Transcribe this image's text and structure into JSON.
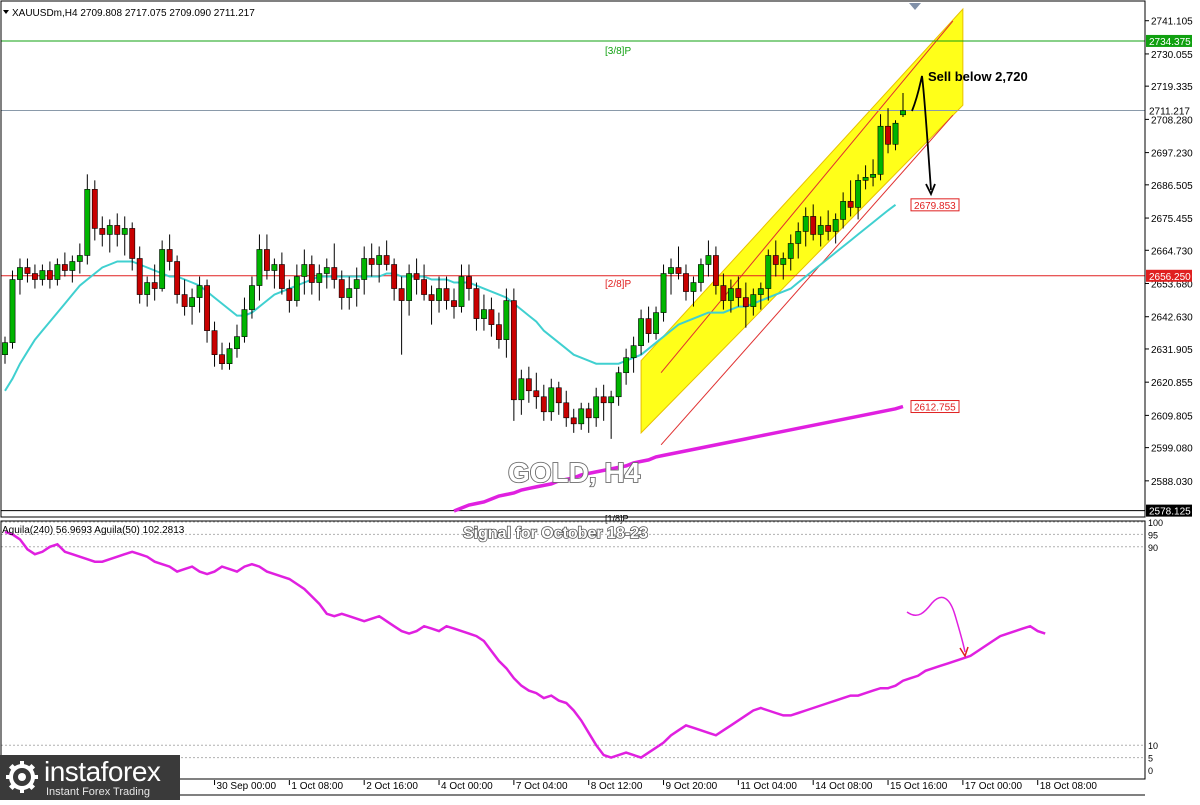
{
  "header": {
    "symbol_line": "XAUUSDm,H4  2709.808 2717.075 2709.090 2711.217"
  },
  "indicator_header": "Aguila(240) 56.9693  Aguila(50) 102.2813",
  "watermark": {
    "title": "GOLD, H4",
    "signal": "Signal for October 18-23"
  },
  "annotation": {
    "sell_text": "Sell below 2,720"
  },
  "murray_labels": {
    "upper": "[3/8]P",
    "middle": "[2/8]P",
    "lower": "[1/8]P"
  },
  "price_tags": {
    "last": "2711.217",
    "upper_line": "2734.375",
    "red_line": "2656.250",
    "ma_fast": "2679.853",
    "ma_slow": "2612.755",
    "bottom": "2578.125"
  },
  "logo": {
    "brand": "instaforex",
    "tagline": "Instant Forex Trading",
    "icon": "gear-logo-icon"
  },
  "colors": {
    "bull": "#00b400",
    "bear": "#c80000",
    "ma_fast": "#40d0d0",
    "ma_slow": "#e020e0",
    "channel": "#ffff00",
    "channel_edge": "#e8c000",
    "red_level": "#e02020",
    "green_level": "#10a010",
    "oscillator": "#e020e0"
  },
  "chart_data": {
    "type": "candlestick",
    "symbol": "XAUUSDm",
    "timeframe": "H4",
    "ylim": [
      2577,
      2746
    ],
    "y_ticks": [
      "2741.105",
      "2730.055",
      "2719.335",
      "2708.280",
      "2697.230",
      "2686.505",
      "2675.455",
      "2664.730",
      "2653.680",
      "2642.630",
      "2631.905",
      "2620.855",
      "2609.805",
      "2599.080",
      "2588.030"
    ],
    "x_ticks": [
      "30 Sep 00:00",
      "1 Oct 08:00",
      "2 Oct 16:00",
      "4 Oct 00:00",
      "7 Oct 04:00",
      "8 Oct 12:00",
      "9 Oct 20:00",
      "11 Oct 04:00",
      "14 Oct 08:00",
      "15 Oct 16:00",
      "17 Oct 00:00",
      "18 Oct 08:00"
    ],
    "x_tick_bar_index": [
      28,
      38,
      48,
      58,
      68,
      78,
      88,
      98,
      108,
      118,
      128,
      138
    ],
    "candles": [
      [
        2630,
        2636,
        2627,
        2634
      ],
      [
        2634,
        2658,
        2632,
        2655
      ],
      [
        2655,
        2662,
        2650,
        2659
      ],
      [
        2659,
        2662,
        2654,
        2657
      ],
      [
        2657,
        2660,
        2652,
        2655
      ],
      [
        2655,
        2660,
        2653,
        2658
      ],
      [
        2658,
        2661,
        2652,
        2655
      ],
      [
        2655,
        2662,
        2653,
        2660
      ],
      [
        2660,
        2664,
        2656,
        2658
      ],
      [
        2658,
        2663,
        2654,
        2661
      ],
      [
        2661,
        2667,
        2657,
        2663
      ],
      [
        2663,
        2690,
        2660,
        2685
      ],
      [
        2685,
        2688,
        2668,
        2672
      ],
      [
        2672,
        2676,
        2666,
        2670
      ],
      [
        2670,
        2675,
        2664,
        2673
      ],
      [
        2673,
        2677,
        2666,
        2670
      ],
      [
        2670,
        2676,
        2663,
        2672
      ],
      [
        2672,
        2674,
        2658,
        2662
      ],
      [
        2662,
        2666,
        2647,
        2650
      ],
      [
        2650,
        2656,
        2646,
        2654
      ],
      [
        2654,
        2660,
        2648,
        2652
      ],
      [
        2652,
        2668,
        2651,
        2665
      ],
      [
        2665,
        2670,
        2658,
        2661
      ],
      [
        2661,
        2663,
        2647,
        2650
      ],
      [
        2650,
        2655,
        2643,
        2646
      ],
      [
        2646,
        2652,
        2640,
        2649
      ],
      [
        2649,
        2656,
        2644,
        2653
      ],
      [
        2653,
        2655,
        2634,
        2638
      ],
      [
        2638,
        2641,
        2626,
        2630
      ],
      [
        2630,
        2634,
        2625,
        2627
      ],
      [
        2627,
        2634,
        2625,
        2632
      ],
      [
        2632,
        2640,
        2629,
        2636
      ],
      [
        2636,
        2649,
        2634,
        2645
      ],
      [
        2645,
        2656,
        2642,
        2653
      ],
      [
        2653,
        2670,
        2648,
        2665
      ],
      [
        2665,
        2670,
        2655,
        2658
      ],
      [
        2658,
        2662,
        2652,
        2660
      ],
      [
        2660,
        2664,
        2650,
        2652
      ],
      [
        2652,
        2655,
        2644,
        2648
      ],
      [
        2648,
        2660,
        2646,
        2656
      ],
      [
        2656,
        2665,
        2650,
        2660
      ],
      [
        2660,
        2663,
        2650,
        2654
      ],
      [
        2654,
        2660,
        2648,
        2657
      ],
      [
        2657,
        2662,
        2652,
        2659
      ],
      [
        2659,
        2667,
        2652,
        2655
      ],
      [
        2655,
        2658,
        2645,
        2649
      ],
      [
        2649,
        2656,
        2645,
        2652
      ],
      [
        2652,
        2659,
        2646,
        2655
      ],
      [
        2655,
        2666,
        2650,
        2662
      ],
      [
        2662,
        2667,
        2656,
        2660
      ],
      [
        2660,
        2666,
        2654,
        2663
      ],
      [
        2663,
        2668,
        2658,
        2660
      ],
      [
        2660,
        2662,
        2648,
        2652
      ],
      [
        2652,
        2656,
        2630,
        2648
      ],
      [
        2648,
        2660,
        2643,
        2657
      ],
      [
        2657,
        2662,
        2650,
        2655
      ],
      [
        2655,
        2660,
        2648,
        2650
      ],
      [
        2650,
        2653,
        2640,
        2648
      ],
      [
        2648,
        2656,
        2644,
        2652
      ],
      [
        2652,
        2656,
        2645,
        2648
      ],
      [
        2648,
        2652,
        2642,
        2646
      ],
      [
        2646,
        2660,
        2644,
        2656
      ],
      [
        2656,
        2660,
        2648,
        2652
      ],
      [
        2652,
        2654,
        2638,
        2642
      ],
      [
        2642,
        2650,
        2638,
        2645
      ],
      [
        2645,
        2649,
        2636,
        2640
      ],
      [
        2640,
        2644,
        2632,
        2635
      ],
      [
        2635,
        2652,
        2629,
        2648
      ],
      [
        2648,
        2652,
        2608,
        2615
      ],
      [
        2615,
        2625,
        2610,
        2622
      ],
      [
        2622,
        2626,
        2614,
        2618
      ],
      [
        2618,
        2624,
        2612,
        2616
      ],
      [
        2616,
        2620,
        2608,
        2611
      ],
      [
        2611,
        2622,
        2608,
        2619
      ],
      [
        2619,
        2621,
        2610,
        2614
      ],
      [
        2614,
        2618,
        2606,
        2609
      ],
      [
        2609,
        2612,
        2604,
        2607
      ],
      [
        2607,
        2614,
        2605,
        2612
      ],
      [
        2612,
        2614,
        2604,
        2609
      ],
      [
        2609,
        2619,
        2606,
        2616
      ],
      [
        2616,
        2620,
        2608,
        2614
      ],
      [
        2614,
        2618,
        2602,
        2616
      ],
      [
        2616,
        2626,
        2613,
        2624
      ],
      [
        2624,
        2632,
        2620,
        2629
      ],
      [
        2629,
        2636,
        2624,
        2633
      ],
      [
        2633,
        2645,
        2630,
        2642
      ],
      [
        2642,
        2646,
        2634,
        2637
      ],
      [
        2637,
        2646,
        2635,
        2644
      ],
      [
        2644,
        2660,
        2641,
        2657
      ],
      [
        2657,
        2662,
        2650,
        2659
      ],
      [
        2659,
        2666,
        2655,
        2657
      ],
      [
        2657,
        2660,
        2648,
        2651
      ],
      [
        2651,
        2656,
        2646,
        2654
      ],
      [
        2654,
        2662,
        2651,
        2660
      ],
      [
        2660,
        2668,
        2656,
        2663
      ],
      [
        2663,
        2666,
        2650,
        2653
      ],
      [
        2653,
        2657,
        2645,
        2648
      ],
      [
        2648,
        2655,
        2644,
        2652
      ],
      [
        2652,
        2656,
        2646,
        2649
      ],
      [
        2649,
        2654,
        2639,
        2646
      ],
      [
        2646,
        2652,
        2643,
        2650
      ],
      [
        2650,
        2654,
        2645,
        2652
      ],
      [
        2652,
        2665,
        2648,
        2663
      ],
      [
        2663,
        2668,
        2656,
        2660
      ],
      [
        2660,
        2664,
        2655,
        2662
      ],
      [
        2662,
        2670,
        2658,
        2667
      ],
      [
        2667,
        2674,
        2662,
        2671
      ],
      [
        2671,
        2679,
        2666,
        2676
      ],
      [
        2676,
        2680,
        2668,
        2670
      ],
      [
        2670,
        2676,
        2666,
        2673
      ],
      [
        2673,
        2678,
        2668,
        2671
      ],
      [
        2671,
        2677,
        2667,
        2675
      ],
      [
        2675,
        2684,
        2672,
        2681
      ],
      [
        2681,
        2688,
        2676,
        2679
      ],
      [
        2679,
        2690,
        2675,
        2688
      ],
      [
        2688,
        2693,
        2685,
        2689
      ],
      [
        2689,
        2695,
        2686,
        2690
      ],
      [
        2690,
        2710,
        2688,
        2706
      ],
      [
        2706,
        2712,
        2697,
        2700
      ],
      [
        2700,
        2708,
        2698,
        2707
      ],
      [
        2709.808,
        2717.075,
        2709.09,
        2711.217
      ]
    ],
    "series": [
      {
        "name": "",
        "note": "fast moving average (cyan)",
        "start_index": 0,
        "values": [
          2618,
          2622,
          2627,
          2631,
          2635,
          2638,
          2641,
          2644,
          2647,
          2650,
          2653,
          2655,
          2657,
          2659,
          2660,
          2661,
          2661,
          2661,
          2660,
          2659,
          2658,
          2657,
          2656,
          2656,
          2655,
          2654,
          2653,
          2651,
          2649,
          2647,
          2645,
          2643,
          2643,
          2644,
          2646,
          2648,
          2650,
          2651,
          2652,
          2653,
          2654,
          2655,
          2656,
          2656,
          2656,
          2656,
          2656,
          2656,
          2656,
          2656,
          2656,
          2657,
          2657,
          2656,
          2656,
          2656,
          2656,
          2655,
          2655,
          2655,
          2654,
          2654,
          2654,
          2653,
          2652,
          2651,
          2650,
          2649,
          2647,
          2645,
          2643,
          2641,
          2638,
          2636,
          2634,
          2632,
          2630,
          2629,
          2628,
          2627,
          2627,
          2627,
          2627,
          2628,
          2629,
          2630,
          2632,
          2634,
          2636,
          2638,
          2640,
          2641,
          2642,
          2643,
          2644,
          2644,
          2644,
          2645,
          2646,
          2646,
          2647,
          2648,
          2649,
          2650,
          2651,
          2652,
          2654,
          2656,
          2658,
          2660,
          2662,
          2664,
          2666,
          2668,
          2670,
          2672,
          2674,
          2676,
          2678,
          2679.853
        ]
      },
      {
        "name": "",
        "note": "slow moving average (magenta)",
        "start_index": 60,
        "values": [
          2578,
          2579,
          2580,
          2580.5,
          2581,
          2582,
          2583,
          2583.5,
          2584,
          2585,
          2585.5,
          2586,
          2586.5,
          2587,
          2588,
          2588.5,
          2589,
          2590,
          2590.5,
          2591,
          2591.5,
          2592,
          2592.5,
          2593,
          2594,
          2594.5,
          2595,
          2596,
          2596.5,
          2597,
          2597.5,
          2598,
          2598.5,
          2599,
          2599.5,
          2600,
          2600.5,
          2601,
          2601.5,
          2602,
          2602.5,
          2603,
          2603.5,
          2604,
          2604.5,
          2605,
          2605.5,
          2606,
          2606.5,
          2607,
          2607.5,
          2608,
          2608.5,
          2609,
          2609.5,
          2610,
          2610.5,
          2611,
          2611.5,
          2612,
          2612.755
        ]
      }
    ],
    "levels": [
      {
        "value": 2734.375,
        "label": "[3/8]P",
        "color": "green"
      },
      {
        "value": 2711.217,
        "label": "",
        "color": "gray"
      },
      {
        "value": 2656.25,
        "label": "[2/8]P",
        "color": "red"
      },
      {
        "value": 2578.125,
        "label": "[1/8]P",
        "color": "black"
      }
    ],
    "channel": {
      "start_index": 85,
      "end_index": 128,
      "lower_start": 2604,
      "lower_end": 2713,
      "upper_start": 2628,
      "upper_end": 2745
    },
    "oscillator": {
      "ylim": [
        0,
        100
      ],
      "y_ticks": [
        "100",
        "95",
        "90",
        "10",
        "5",
        "0"
      ],
      "values": [
        96,
        95,
        93,
        89,
        87,
        88,
        90,
        91,
        88,
        87,
        86,
        85,
        84,
        84,
        85,
        86,
        87,
        88,
        87,
        86,
        84,
        83,
        82,
        80,
        81,
        82,
        80,
        79,
        80,
        82,
        81,
        80,
        82,
        83,
        82,
        80,
        79,
        78,
        77,
        75,
        73,
        70,
        67,
        63,
        62,
        63,
        62,
        61,
        60,
        61,
        62,
        60,
        58,
        56,
        55,
        56,
        58,
        57,
        56,
        58,
        57,
        56,
        55,
        54,
        52,
        48,
        44,
        41,
        37,
        34,
        32,
        31,
        29,
        30,
        28,
        27,
        24,
        20,
        15,
        10,
        6,
        5,
        6,
        7,
        6,
        5,
        7,
        9,
        11,
        14,
        16,
        18,
        17,
        16,
        15,
        14,
        16,
        18,
        20,
        22,
        24,
        25,
        24,
        23,
        22,
        22,
        23,
        24,
        25,
        26,
        27,
        28,
        29,
        30,
        30,
        31,
        32,
        33,
        33,
        34,
        36,
        37,
        38,
        40,
        41,
        42,
        43,
        44,
        45,
        46,
        48,
        50,
        52,
        54,
        55,
        56,
        57,
        58,
        56,
        55
      ]
    }
  }
}
